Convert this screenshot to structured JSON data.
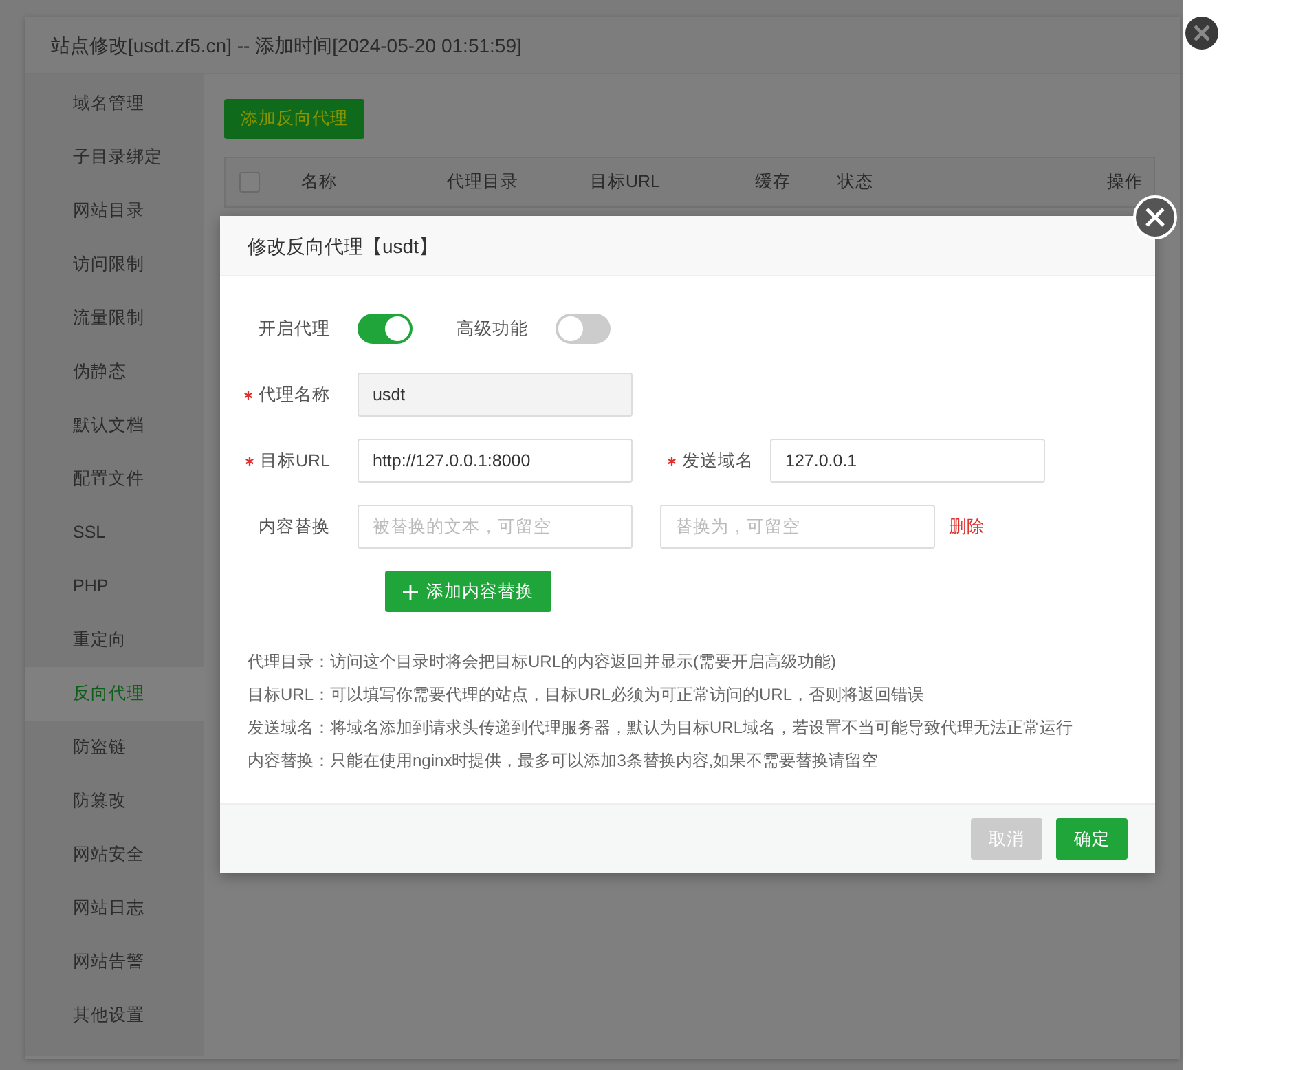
{
  "site_dialog": {
    "title": "站点修改[usdt.zf5.cn] -- 添加时间[2024-05-20 01:51:59]"
  },
  "sidebar": {
    "items": [
      {
        "label": "域名管理",
        "selected": false
      },
      {
        "label": "子目录绑定",
        "selected": false
      },
      {
        "label": "网站目录",
        "selected": false
      },
      {
        "label": "访问限制",
        "selected": false
      },
      {
        "label": "流量限制",
        "selected": false
      },
      {
        "label": "伪静态",
        "selected": false
      },
      {
        "label": "默认文档",
        "selected": false
      },
      {
        "label": "配置文件",
        "selected": false
      },
      {
        "label": "SSL",
        "selected": false
      },
      {
        "label": "PHP",
        "selected": false
      },
      {
        "label": "重定向",
        "selected": false
      },
      {
        "label": "反向代理",
        "selected": true
      },
      {
        "label": "防盗链",
        "selected": false
      },
      {
        "label": "防篡改",
        "selected": false
      },
      {
        "label": "网站安全",
        "selected": false
      },
      {
        "label": "网站日志",
        "selected": false
      },
      {
        "label": "网站告警",
        "selected": false
      },
      {
        "label": "其他设置",
        "selected": false
      }
    ]
  },
  "add_proxy_button": "添加反向代理",
  "table": {
    "select_all_checked": false,
    "columns": [
      "名称",
      "代理目录",
      "目标URL",
      "缓存",
      "状态",
      "操作"
    ]
  },
  "modal": {
    "title": "修改反向代理【usdt】",
    "toggles": [
      {
        "label": "开启代理",
        "on": true
      },
      {
        "label": "高级功能",
        "on": false
      }
    ],
    "rows": [
      {
        "fields": [
          {
            "label": "代理名称",
            "required": true,
            "value": "usdt",
            "disabled": true
          }
        ]
      },
      {
        "fields": [
          {
            "label": "目标URL",
            "required": true,
            "value": "http://127.0.0.1:8000",
            "disabled": false
          },
          {
            "label": "发送域名",
            "required": true,
            "value": "127.0.0.1",
            "disabled": false
          }
        ]
      },
      {
        "fields": [
          {
            "label": "内容替换",
            "required": false,
            "placeholder": "被替换的文本，可留空",
            "disabled": false
          },
          {
            "required": false,
            "placeholder": "替换为，可留空",
            "disabled": false
          }
        ],
        "action": "删除"
      }
    ],
    "add_replace_button": "添加内容替换",
    "help": [
      "代理目录：访问这个目录时将会把目标URL的内容返回并显示(需要开启高级功能)",
      "目标URL：可以填写你需要代理的站点，目标URL必须为可正常访问的URL，否则将返回错误",
      "发送域名：将域名添加到请求头传递到代理服务器，默认为目标URL域名，若设置不当可能导致代理无法正常运行",
      "内容替换：只能在使用nginx时提供，最多可以添加3条替换内容,如果不需要替换请留空"
    ],
    "buttons": [
      {
        "label": "取消",
        "kind": "secondary"
      },
      {
        "label": "确定",
        "kind": "primary"
      }
    ]
  }
}
